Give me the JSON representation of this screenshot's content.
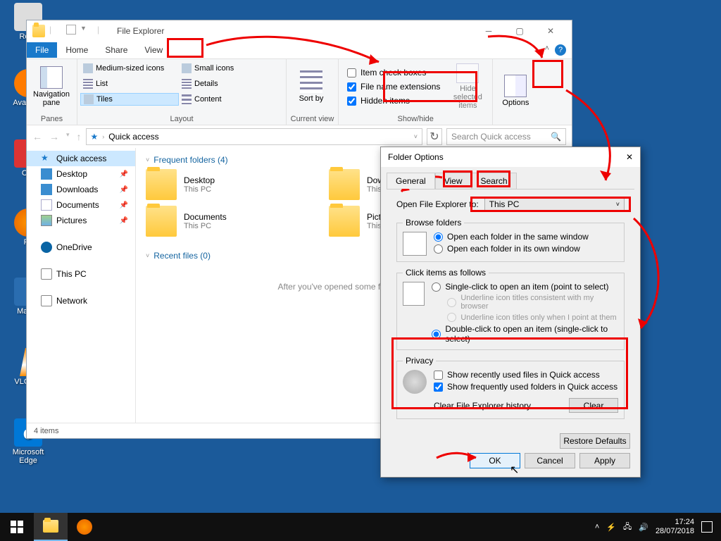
{
  "desktop": {
    "icons": [
      "Recy",
      "Avas\nAnt",
      "CCl",
      "Fir",
      "Malwa",
      "VLC\npla",
      "Microsoft\nEdge"
    ]
  },
  "explorer": {
    "title": "File Explorer",
    "tabs": {
      "file": "File",
      "home": "Home",
      "share": "Share",
      "view": "View"
    },
    "ribbon": {
      "panes": {
        "nav": "Navigation\npane",
        "label": "Panes"
      },
      "layout": {
        "items": [
          [
            "Medium-sized icons",
            "Small icons"
          ],
          [
            "List",
            "Details"
          ],
          [
            "Tiles",
            "Content"
          ]
        ],
        "selected": "Tiles",
        "label": "Layout"
      },
      "currentview": {
        "sort": "Sort\nby",
        "label": "Current view"
      },
      "showhide": {
        "chk_itemcheck": "Item check boxes",
        "chk_ext": "File name extensions",
        "chk_hidden": "Hidden items",
        "hide": "Hide selected\nitems",
        "label": "Show/hide"
      },
      "options": "Options"
    },
    "address": {
      "path": "Quick access",
      "search_placeholder": "Search Quick access"
    },
    "sidebar": {
      "quick": "Quick access",
      "items": [
        "Desktop",
        "Downloads",
        "Documents",
        "Pictures"
      ],
      "onedrive": "OneDrive",
      "thispc": "This PC",
      "network": "Network"
    },
    "content": {
      "frequent_header": "Frequent folders (4)",
      "tiles": [
        {
          "name": "Desktop",
          "sub": "This PC"
        },
        {
          "name": "Dow",
          "sub": "This"
        },
        {
          "name": "Documents",
          "sub": "This PC"
        },
        {
          "name": "Pictu",
          "sub": "This"
        }
      ],
      "recent_header": "Recent files (0)",
      "empty": "After you've opened some files, we'll sho"
    },
    "status": "4 items"
  },
  "dialog": {
    "title": "Folder Options",
    "tabs": [
      "General",
      "View",
      "Search"
    ],
    "open_label": "Open File Explorer to:",
    "open_value": "This PC",
    "browse": {
      "legend": "Browse folders",
      "r1": "Open each folder in the same window",
      "r2": "Open each folder in its own window"
    },
    "click": {
      "legend": "Click items as follows",
      "r1": "Single-click to open an item (point to select)",
      "r1a": "Underline icon titles consistent with my browser",
      "r1b": "Underline icon titles only when I point at them",
      "r2": "Double-click to open an item (single-click to select)"
    },
    "privacy": {
      "legend": "Privacy",
      "c1": "Show recently used files in Quick access",
      "c2": "Show frequently used folders in Quick access",
      "clear_label": "Clear File Explorer history",
      "clear_btn": "Clear"
    },
    "restore": "Restore Defaults",
    "ok": "OK",
    "cancel": "Cancel",
    "apply": "Apply"
  },
  "taskbar": {
    "time": "17:24",
    "date": "28/07/2018"
  }
}
